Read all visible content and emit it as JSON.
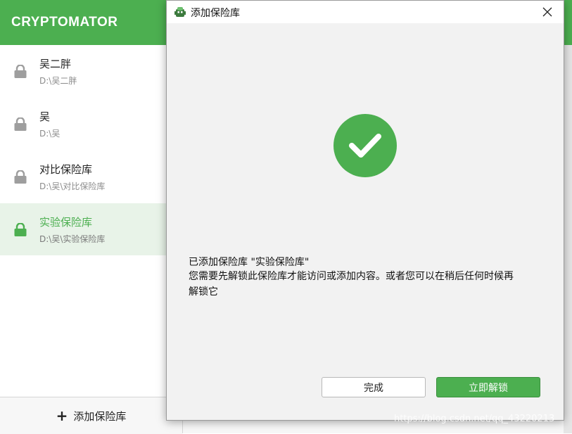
{
  "app": {
    "title": "CRYPTOMATOR",
    "accent_color": "#4caf50"
  },
  "sidebar": {
    "vaults": [
      {
        "name": "吴二胖",
        "path": "D:\\吴二胖",
        "icon": "lock-icon",
        "selected": false
      },
      {
        "name": "吴",
        "path": "D:\\吴",
        "icon": "lock-icon",
        "selected": false
      },
      {
        "name": "对比保险库",
        "path": "D:\\吴\\对比保险库",
        "icon": "lock-icon",
        "selected": false
      },
      {
        "name": "实验保险库",
        "path": "D:\\吴\\实验保险库",
        "icon": "lock-icon",
        "selected": true
      }
    ],
    "add_vault_label": "添加保险库",
    "add_vault_icon": "plus-icon"
  },
  "dialog": {
    "title": "添加保险库",
    "close_icon": "close-icon",
    "status_icon": "success-check-icon",
    "message_line1": "已添加保险库 \"实验保险库\"",
    "message_line2": "您需要先解锁此保险库才能访问或添加内容。或者您可以在稍后任何时候再",
    "message_line3": "解锁它",
    "done_button": "完成",
    "unlock_button": "立即解锁"
  },
  "watermark": "https://blog.csdn.net/qq_43220213"
}
